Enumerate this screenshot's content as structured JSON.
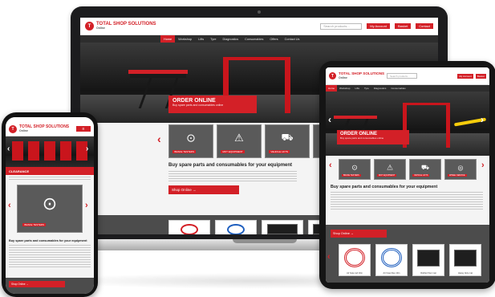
{
  "brand": {
    "name": "TOTAL SHOP SOLUTIONS",
    "tagline": "Online",
    "accent": "#d32027"
  },
  "header": {
    "search_placeholder": "Search products...",
    "buttons": [
      "My Account",
      "Basket",
      "Contact"
    ]
  },
  "nav": {
    "items": [
      "Home",
      "Workshop",
      "Lifts",
      "Tyre",
      "Diagnostics",
      "Consumables",
      "Offers",
      "Contact Us"
    ]
  },
  "hero": {
    "title": "ORDER ONLINE",
    "subtitle": "Buy spare parts and consumables online",
    "prev_icon": "chevron-left-icon",
    "next_icon": "chevron-right-icon"
  },
  "phone_hero": {
    "title": "CLEARANCE"
  },
  "categories": [
    {
      "label": "BRAKE TESTERS",
      "icon": "brake-icon"
    },
    {
      "label": "MOT EQUIPMENT",
      "icon": "mot-triangle-icon"
    },
    {
      "label": "VEHICLE LIFTS",
      "icon": "lift-icon"
    },
    {
      "label": "WHEEL SERVICE",
      "icon": "wheel-icon"
    }
  ],
  "main": {
    "title": "Buy spare parts and consumables for your equipment",
    "phone_title": "Buy spare parts and consumables for your equipment",
    "shop_button": "Shop Online →"
  },
  "products": [
    {
      "caption": "Air hose red 10m",
      "color": "#d32027"
    },
    {
      "caption": "Air hose blue 10m",
      "color": "#1f5fbf"
    },
    {
      "caption": "Rubber floor mat",
      "color": "#1e1e1e"
    },
    {
      "caption": "Heavy duty mat",
      "color": "#1e1e1e"
    }
  ]
}
